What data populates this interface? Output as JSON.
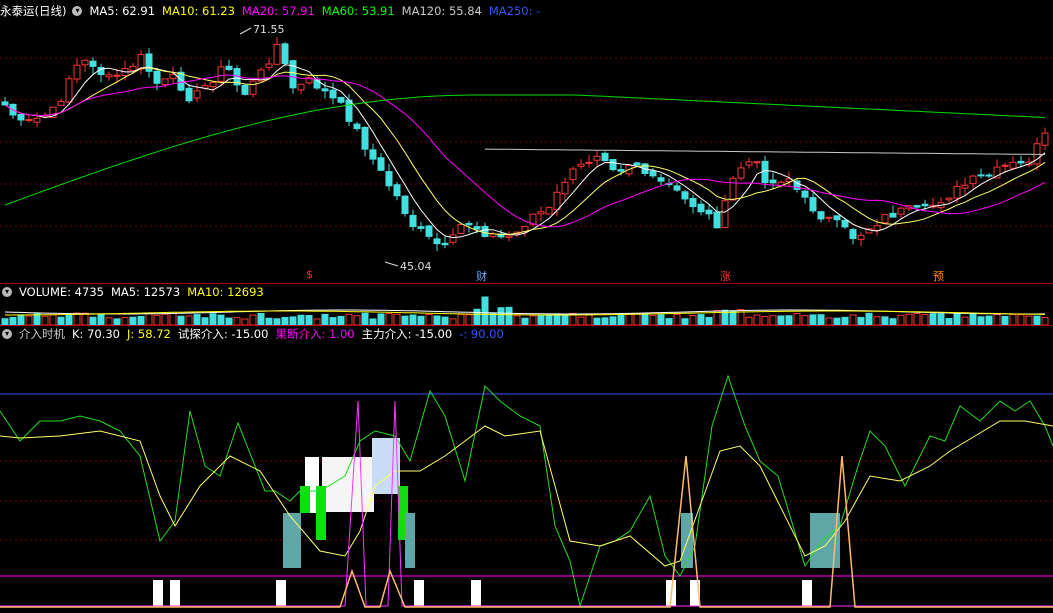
{
  "price_panel": {
    "title": "永泰运(日线)",
    "indicators": [
      {
        "label": "MA5: 62.91",
        "color": "#ffffff"
      },
      {
        "label": "MA10: 61.23",
        "color": "#ffff00"
      },
      {
        "label": "MA20: 57.91",
        "color": "#ff00ff"
      },
      {
        "label": "MA60: 53.91",
        "color": "#00ff00"
      },
      {
        "label": "MA120: 55.84",
        "color": "#c8c8c8"
      },
      {
        "label": "MA250: -",
        "color": "#3355ff"
      }
    ],
    "high_label": "71.55",
    "low_label": "45.04",
    "events": [
      {
        "label": "$",
        "color": "#ff3030"
      },
      {
        "label": "财",
        "color": "#6fa8ff"
      },
      {
        "label": "涨",
        "color": "#ff3030"
      },
      {
        "label": "预",
        "color": "#ff8c00"
      }
    ]
  },
  "volume_panel": {
    "indicators": [
      {
        "label": "VOLUME: 4735",
        "color": "#ffffff"
      },
      {
        "label": "MA5: 12573",
        "color": "#ffffff"
      },
      {
        "label": "MA10: 12693",
        "color": "#ffff00"
      }
    ]
  },
  "timing_panel": {
    "indicators": [
      {
        "label": "介入时机",
        "color": "#c8c8c8"
      },
      {
        "label": "K: 70.30",
        "color": "#ffffff"
      },
      {
        "label": "J: 58.72",
        "color": "#ffff00"
      },
      {
        "label": "试探介入: -15.00",
        "color": "#ffffff"
      },
      {
        "label": "果断介入: 1.00",
        "color": "#ff00ff"
      },
      {
        "label": "主力介入: -15.00",
        "color": "#ffffff"
      },
      {
        "label": "-: 90.00",
        "color": "#3355ff"
      }
    ]
  },
  "colors": {
    "up": "#ff3333",
    "down": "#40e0e0",
    "ma5": "#ffffff",
    "ma10": "#ffff66",
    "ma20": "#ff00ff",
    "ma60": "#00dd00",
    "ma120": "#c8c8c8",
    "grid": "#800000"
  }
}
